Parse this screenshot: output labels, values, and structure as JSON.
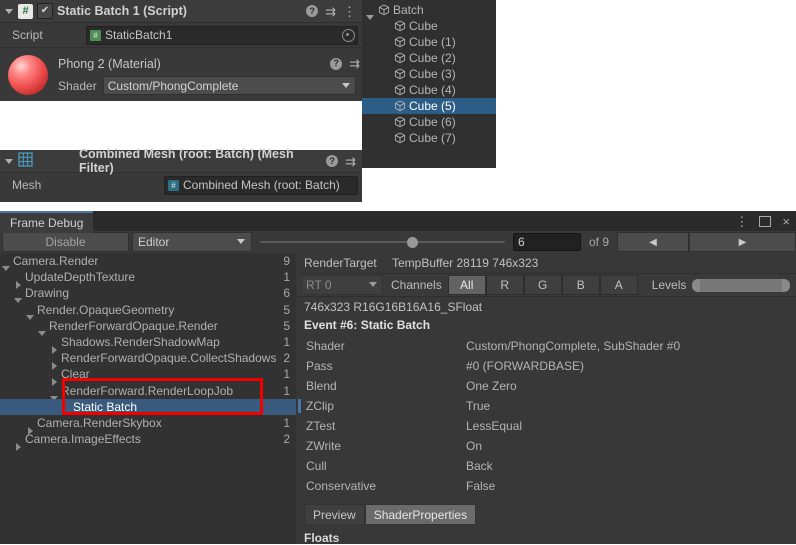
{
  "inspector": {
    "script_component": {
      "title": "Static Batch 1 (Script)",
      "enabled_check": "✔",
      "script_icon_glyph": "#",
      "field_label": "Script",
      "field_value": "StaticBatch1"
    },
    "material": {
      "title": "Phong 2 (Material)",
      "shader_label": "Shader",
      "shader_value": "Custom/PhongComplete"
    },
    "mesh_filter": {
      "title": "Combined Mesh (root: Batch) (Mesh Filter)",
      "field_label": "Mesh",
      "field_value": "Combined Mesh (root: Batch)"
    },
    "icons": {
      "help": "?",
      "preset": "⇉",
      "menu": "⋮"
    }
  },
  "hierarchy": {
    "rows": [
      {
        "label": "Batch",
        "indent": 0,
        "expanded": true,
        "selected": false
      },
      {
        "label": "Cube",
        "indent": 1,
        "expanded": false,
        "selected": false
      },
      {
        "label": "Cube (1)",
        "indent": 1,
        "expanded": false,
        "selected": false
      },
      {
        "label": "Cube (2)",
        "indent": 1,
        "expanded": false,
        "selected": false
      },
      {
        "label": "Cube (3)",
        "indent": 1,
        "expanded": false,
        "selected": false
      },
      {
        "label": "Cube (4)",
        "indent": 1,
        "expanded": false,
        "selected": false
      },
      {
        "label": "Cube (5)",
        "indent": 1,
        "expanded": false,
        "selected": true
      },
      {
        "label": "Cube (6)",
        "indent": 1,
        "expanded": false,
        "selected": false
      },
      {
        "label": "Cube (7)",
        "indent": 1,
        "expanded": false,
        "selected": false
      }
    ]
  },
  "frame_debug": {
    "tab_title": "Frame Debug",
    "window_controls": {
      "menu": "⋮",
      "maximize": "",
      "close": "×"
    },
    "toolbar": {
      "disable_label": "Disable",
      "target_popup": "Editor",
      "event_index": "6",
      "of_label": "of 9",
      "prev_arrow": "◀",
      "next_arrow": "▶"
    },
    "tree": [
      {
        "label": "Camera.Render",
        "count": "9",
        "indent": 0,
        "tri": "open",
        "selected": false
      },
      {
        "label": "UpdateDepthTexture",
        "count": "1",
        "indent": 1,
        "tri": "closed",
        "selected": false
      },
      {
        "label": "Drawing",
        "count": "6",
        "indent": 1,
        "tri": "open",
        "selected": false
      },
      {
        "label": "Render.OpaqueGeometry",
        "count": "5",
        "indent": 2,
        "tri": "open",
        "selected": false
      },
      {
        "label": "RenderForwardOpaque.Render",
        "count": "5",
        "indent": 3,
        "tri": "open",
        "selected": false
      },
      {
        "label": "Shadows.RenderShadowMap",
        "count": "1",
        "indent": 4,
        "tri": "closed",
        "selected": false
      },
      {
        "label": "RenderForwardOpaque.CollectShadows",
        "count": "2",
        "indent": 4,
        "tri": "closed",
        "selected": false
      },
      {
        "label": "Clear",
        "count": "1",
        "indent": 4,
        "tri": "closed",
        "selected": false
      },
      {
        "label": "RenderForward.RenderLoopJob",
        "count": "1",
        "indent": 4,
        "tri": "open",
        "selected": false
      },
      {
        "label": "Static Batch",
        "count": "",
        "indent": 5,
        "tri": "none",
        "selected": true
      },
      {
        "label": "Camera.RenderSkybox",
        "count": "1",
        "indent": 2,
        "tri": "closed",
        "selected": false
      },
      {
        "label": "Camera.ImageEffects",
        "count": "2",
        "indent": 1,
        "tri": "closed",
        "selected": false
      }
    ],
    "highlight_color": "#f20000",
    "detail": {
      "render_target_label": "RenderTarget",
      "render_target_value": "TempBuffer 28119 746x323",
      "rt_popup": "RT 0",
      "channels_label": "Channels",
      "channel_buttons": [
        "All",
        "R",
        "G",
        "B",
        "A"
      ],
      "channel_selected": "All",
      "levels_label": "Levels",
      "format_line": "746x323 R16G16B16A16_SFloat",
      "event_line": "Event #6: Static Batch",
      "properties": [
        {
          "key": "Shader",
          "value": "Custom/PhongComplete, SubShader #0"
        },
        {
          "key": "Pass",
          "value": "#0 (FORWARDBASE)"
        },
        {
          "key": "Blend",
          "value": "One Zero"
        },
        {
          "key": "ZClip",
          "value": "True"
        },
        {
          "key": "ZTest",
          "value": "LessEqual"
        },
        {
          "key": "ZWrite",
          "value": "On"
        },
        {
          "key": "Cull",
          "value": "Back"
        },
        {
          "key": "Conservative",
          "value": "False"
        }
      ],
      "preview_tabs": [
        {
          "label": "Preview",
          "active": false
        },
        {
          "label": "ShaderProperties",
          "active": true
        }
      ],
      "floats_header": "Floats"
    }
  }
}
